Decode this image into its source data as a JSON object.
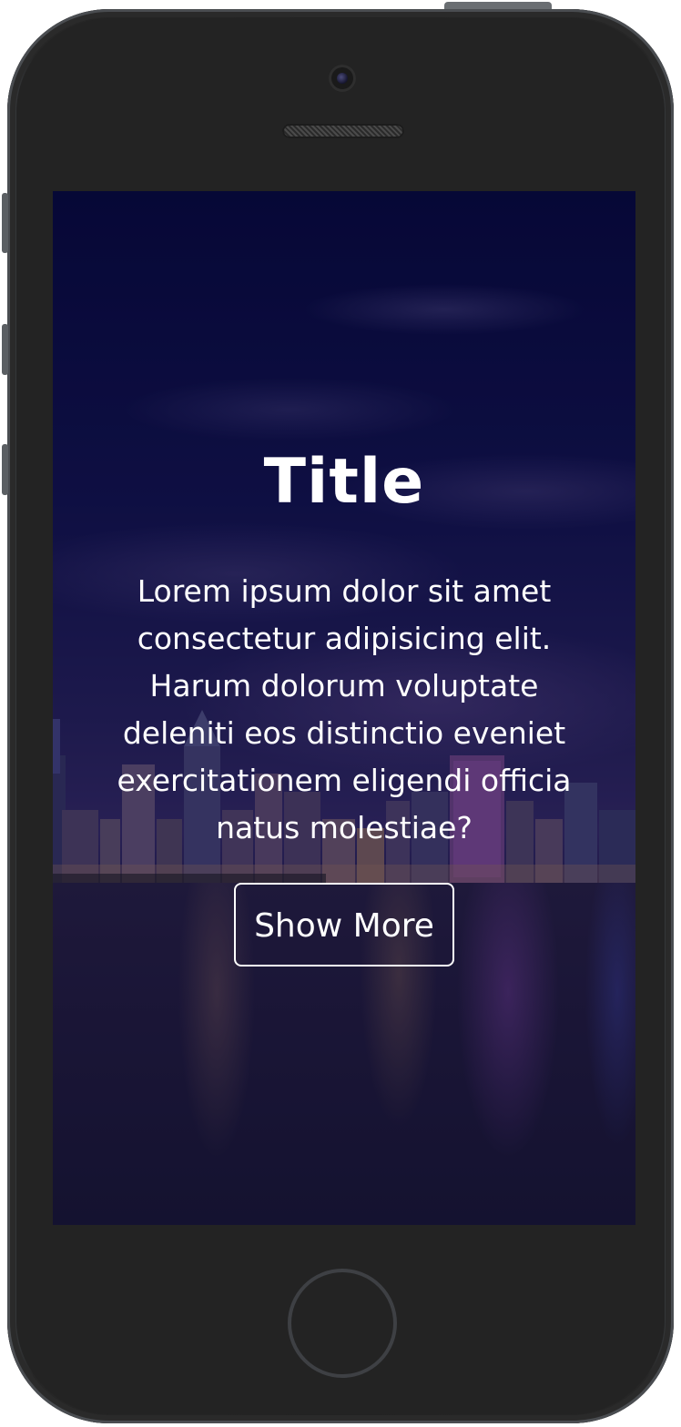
{
  "device": {
    "frame_color": "#232323",
    "screen_overlay_color": "#0a0a32"
  },
  "hero": {
    "title": "Title",
    "description": "Lorem ipsum dolor sit amet consectetur adipisicing elit. Harum dolorum voluptate deleniti eos distinctio eveniet exercitationem eligendi officia natus molestiae?",
    "button_label": "Show More",
    "background_image": "night-city-skyline"
  }
}
